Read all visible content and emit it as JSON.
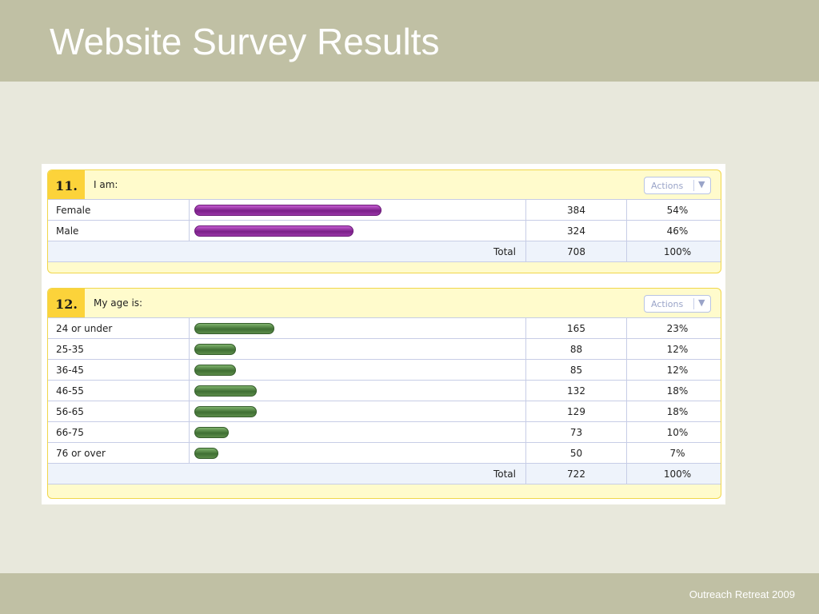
{
  "slide": {
    "title": "Website Survey Results",
    "footer": "Outreach Retreat 2009"
  },
  "colors": {
    "header_band": "#c0c0a4",
    "background": "#e8e8dc",
    "q11_bar": "#8a2a98",
    "q12_bar": "#4a7a3d",
    "question_number_bg": "#fcd33a"
  },
  "questions": [
    {
      "number": "11.",
      "text": "I am:",
      "actions_label": "Actions",
      "actions_icon": "chevron-down-icon",
      "rows": [
        {
          "label": "Female",
          "count": "384",
          "percent": "54%",
          "share": 0.54
        },
        {
          "label": "Male",
          "count": "324",
          "percent": "46%",
          "share": 0.46
        }
      ],
      "total": {
        "label": "Total",
        "count": "708",
        "percent": "100%"
      }
    },
    {
      "number": "12.",
      "text": "My age is:",
      "actions_label": "Actions",
      "actions_icon": "chevron-down-icon",
      "rows": [
        {
          "label": "24 or under",
          "count": "165",
          "percent": "23%",
          "share": 0.23
        },
        {
          "label": "25-35",
          "count": "88",
          "percent": "12%",
          "share": 0.12
        },
        {
          "label": "36-45",
          "count": "85",
          "percent": "12%",
          "share": 0.12
        },
        {
          "label": "46-55",
          "count": "132",
          "percent": "18%",
          "share": 0.18
        },
        {
          "label": "56-65",
          "count": "129",
          "percent": "18%",
          "share": 0.18
        },
        {
          "label": "66-75",
          "count": "73",
          "percent": "10%",
          "share": 0.1
        },
        {
          "label": "76 or over",
          "count": "50",
          "percent": "7%",
          "share": 0.07
        }
      ],
      "total": {
        "label": "Total",
        "count": "722",
        "percent": "100%"
      }
    }
  ]
}
